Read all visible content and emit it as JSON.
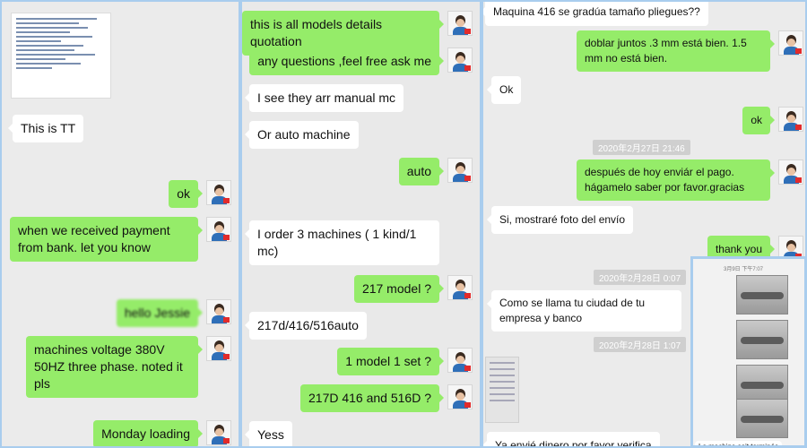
{
  "panel1": {
    "msg_this_is_tt": "This is TT",
    "msg_ok": "ok",
    "msg_payment": "when we received payment from bank. let you know",
    "msg_hello": "hello Jessie",
    "msg_voltage": "machines voltage 380V 50HZ three phase. noted it pls",
    "msg_monday": "Monday loading"
  },
  "panel2": {
    "msg_quotation": "this is all models details quotation",
    "msg_questions": "any questions ,feel free ask me",
    "msg_manual": "I see they arr manual mc",
    "msg_auto_machine": "Or auto machine",
    "msg_auto": "auto",
    "msg_order": "I order 3 machines ( 1 kind/1 mc)",
    "msg_217_model": "217 model ?",
    "msg_models": "217d/416/516auto",
    "msg_1_model": "1 model 1 set ?",
    "msg_217d": "217D 416 and 516D ?",
    "msg_yess": "Yess"
  },
  "panel3": {
    "msg_maquina": "Maquina 416 se gradúa tamaño pliegues??",
    "msg_doblar": "doblar juntos .3 mm está bien. 1.5 mm no está bien.",
    "msg_ok": "Ok",
    "msg_ok2": "ok",
    "ts_1": "2020年2月27日 21:46",
    "msg_despues": "después de hoy enviár el pago. hágamelo saber por favor.gracias",
    "msg_foto": "Si, mostraré foto del envío",
    "msg_thank": "thank you",
    "ts_2": "2020年2月28日 0:07",
    "msg_ciudad": "Como se llama tu ciudad de tu empresa y banco",
    "ts_3": "2020年2月28日 1:07",
    "msg_dinero": "Ya envié dinero por favor verifica"
  },
  "panel4": {
    "ts": "3月9日 下午7:07",
    "msg_caption": "La machine soit terminée"
  },
  "colors": {
    "outgoing": "#95ec69",
    "incoming": "#ffffff",
    "border": "#a9cdee",
    "background": "#ebebeb"
  }
}
